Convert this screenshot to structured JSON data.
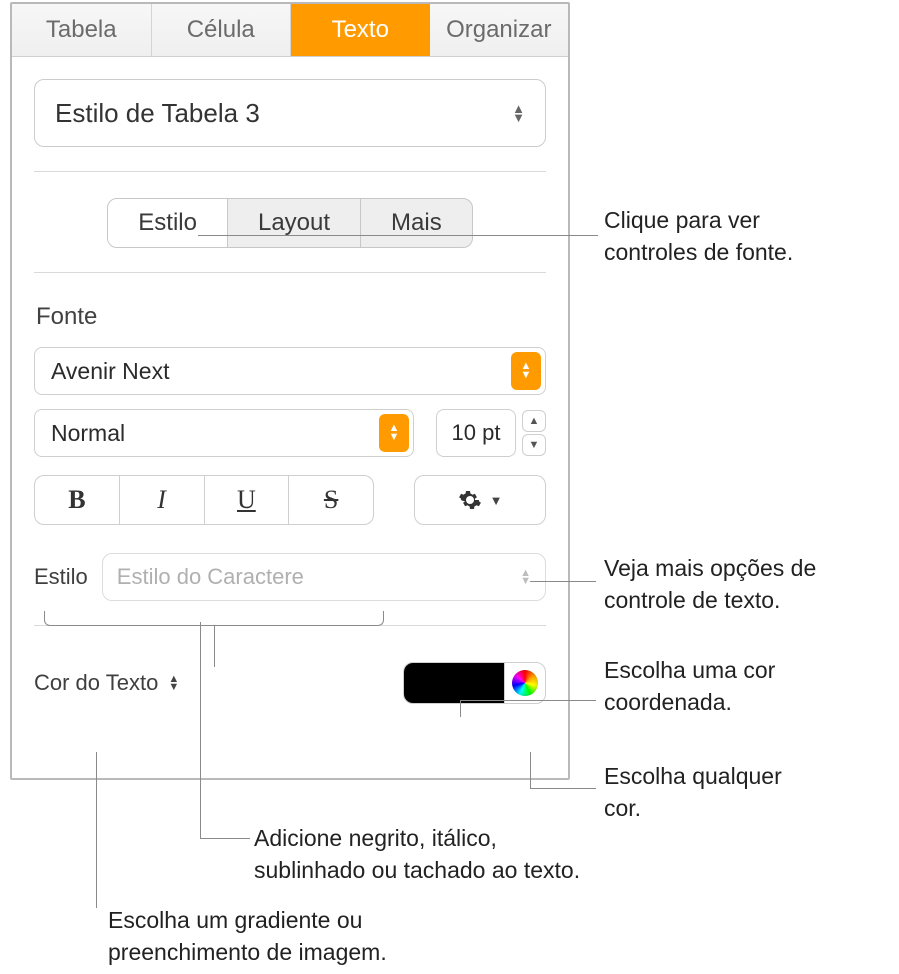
{
  "top_tabs": {
    "tabela": "Tabela",
    "celula": "Célula",
    "texto": "Texto",
    "organizar": "Organizar"
  },
  "paragraph_style": "Estilo de Tabela 3",
  "sub_tabs": {
    "estilo": "Estilo",
    "layout": "Layout",
    "mais": "Mais"
  },
  "font": {
    "section_label": "Fonte",
    "family": "Avenir Next",
    "weight": "Normal",
    "size": "10 pt",
    "b": "B",
    "i": "I",
    "u": "U",
    "s": "S"
  },
  "char_style": {
    "label": "Estilo",
    "placeholder": "Estilo do Caractere"
  },
  "text_color": {
    "label": "Cor do Texto",
    "swatch": "#000000"
  },
  "callouts": {
    "font_controls": "Clique para ver\ncontroles de fonte.",
    "gear": "Veja mais opções de\ncontrole de texto.",
    "swatch": "Escolha uma cor\ncoordenada.",
    "wheel": "Escolha qualquer\ncor.",
    "bius": "Adicione negrito, itálico,\nsublinhado ou tachado ao texto.",
    "color_label": "Escolha um gradiente ou\npreenchimento de imagem."
  }
}
